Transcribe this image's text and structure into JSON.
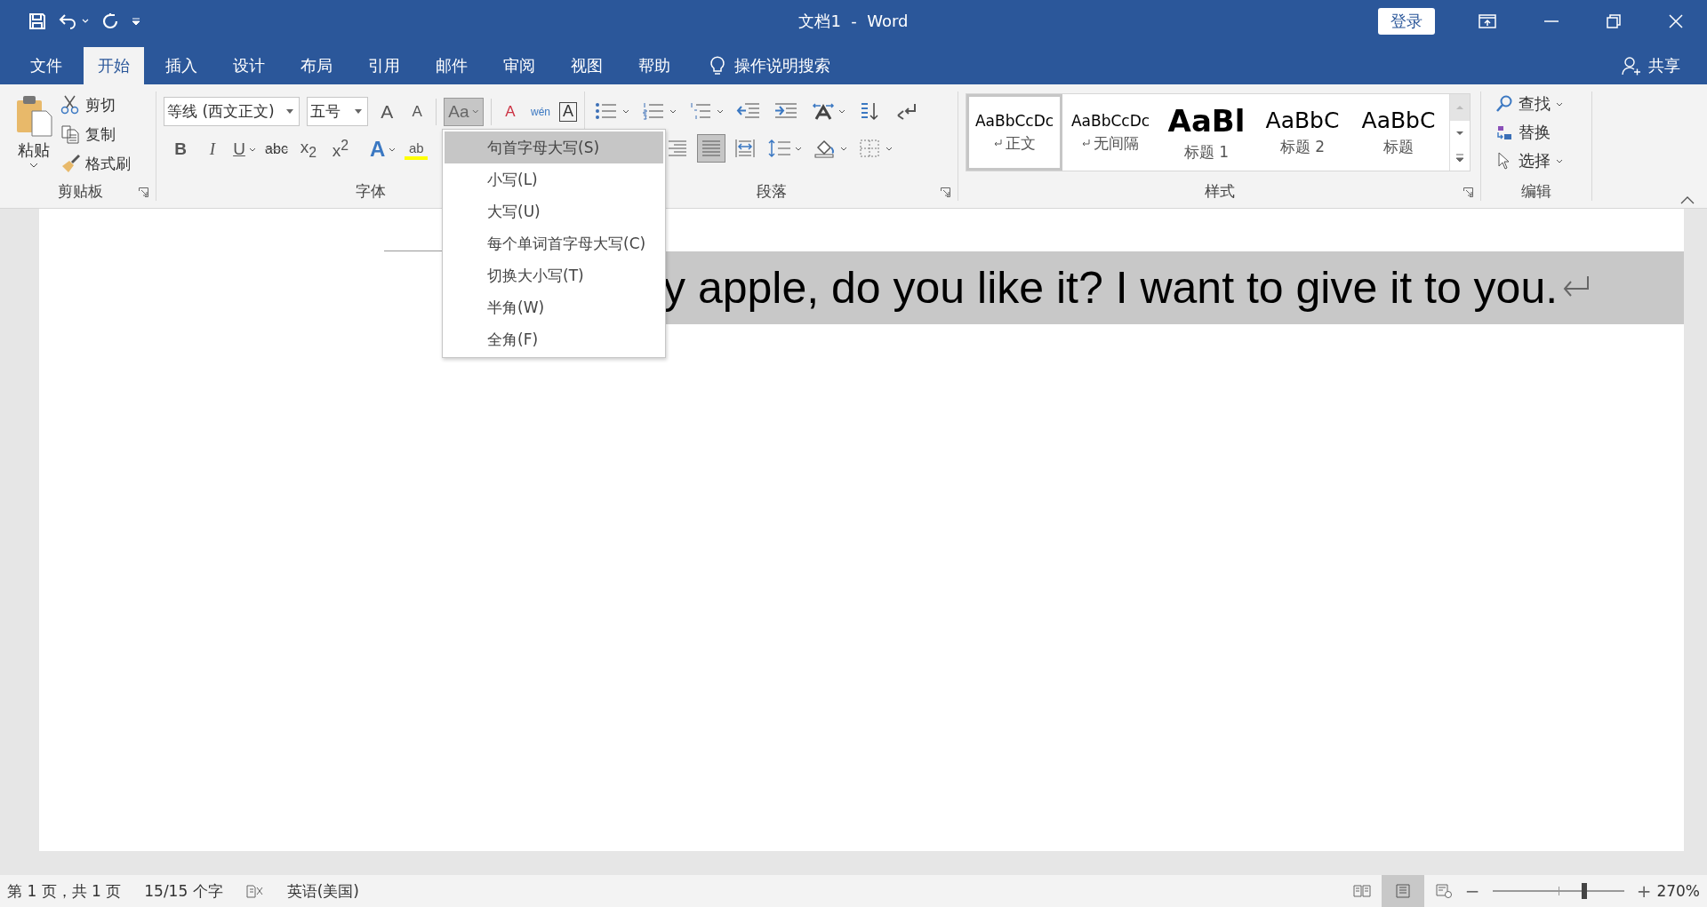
{
  "window": {
    "title": "文档1  -  Word",
    "login": "登录"
  },
  "tabs": [
    {
      "label": "文件",
      "selected": false
    },
    {
      "label": "开始",
      "selected": true
    },
    {
      "label": "插入",
      "selected": false
    },
    {
      "label": "设计",
      "selected": false
    },
    {
      "label": "布局",
      "selected": false
    },
    {
      "label": "引用",
      "selected": false
    },
    {
      "label": "邮件",
      "selected": false
    },
    {
      "label": "审阅",
      "selected": false
    },
    {
      "label": "视图",
      "selected": false
    },
    {
      "label": "帮助",
      "selected": false
    }
  ],
  "tell_me": "操作说明搜索",
  "share": "共享",
  "clipboard": {
    "paste": "粘贴",
    "items": [
      {
        "kind": "cut",
        "label": "剪切"
      },
      {
        "kind": "copy",
        "label": "复制"
      },
      {
        "kind": "painter",
        "label": "格式刷"
      }
    ],
    "label": "剪贴板"
  },
  "font": {
    "name": "等线 (西文正文)",
    "size": "五号",
    "label": "字体",
    "row1": [
      {
        "kind": "grow",
        "text": "A"
      },
      {
        "kind": "shrink",
        "text": "A"
      }
    ],
    "case_button": {
      "text": "Aa",
      "pressed": true
    },
    "row1b": [
      {
        "kind": "clear",
        "text": "A"
      },
      {
        "kind": "phonetic",
        "text": "wén"
      },
      {
        "kind": "border",
        "text": "A"
      }
    ],
    "row2": [
      {
        "kind": "bold",
        "text": "B"
      },
      {
        "kind": "italic",
        "text": "I"
      },
      {
        "kind": "underline",
        "text": "U"
      },
      {
        "kind": "strike",
        "text": "abc"
      },
      {
        "kind": "sub",
        "text": "x$_{2}$"
      },
      {
        "kind": "sup",
        "text": "x$^{2}$"
      },
      {
        "kind": "effects",
        "text": "A"
      },
      {
        "kind": "highlight",
        "text": "ab"
      }
    ]
  },
  "paragraph": {
    "label": "段落",
    "row1": [
      {
        "kind": "bullets"
      },
      {
        "kind": "numbering"
      },
      {
        "kind": "multilevel"
      },
      {
        "kind": "outdent"
      },
      {
        "kind": "indent"
      },
      {
        "kind": "asian"
      },
      {
        "kind": "sort"
      },
      {
        "kind": "marks"
      }
    ],
    "align": [
      {
        "kind": "right",
        "selected": false
      },
      {
        "kind": "justify",
        "selected": true
      },
      {
        "kind": "distributed",
        "selected": false
      }
    ],
    "row2": [
      {
        "kind": "spacing"
      },
      {
        "kind": "shading"
      },
      {
        "kind": "borders"
      }
    ]
  },
  "styles": {
    "label": "样式",
    "items": [
      {
        "sample": "AaBbCcDc",
        "name": "正文",
        "kind": "normal",
        "selected": true
      },
      {
        "sample": "AaBbCcDc",
        "name": "无间隔",
        "kind": "normal",
        "selected": false
      },
      {
        "sample": "AaBl",
        "name": "标题 1",
        "kind": "h1",
        "selected": false
      },
      {
        "sample": "AaBbC",
        "name": "标题 2",
        "kind": "h2",
        "selected": false
      },
      {
        "sample": "AaBbC",
        "name": "标题",
        "kind": "title",
        "selected": false
      }
    ]
  },
  "editing": {
    "label": "编辑",
    "items": [
      {
        "kind": "find",
        "label": "查找",
        "dropdown": true
      },
      {
        "kind": "replace",
        "label": "替换",
        "dropdown": false
      },
      {
        "kind": "select",
        "label": "选择",
        "dropdown": true
      }
    ]
  },
  "case_menu": {
    "items": [
      {
        "label": "句首字母大写(S)",
        "selected": true
      },
      {
        "label": "小写(L)",
        "selected": false
      },
      {
        "label": "大写(U)",
        "selected": false
      },
      {
        "label": "每个单词首字母大写(C)",
        "selected": false
      },
      {
        "label": "切换大小写(T)",
        "selected": false
      },
      {
        "label": "半角(W)",
        "selected": false
      },
      {
        "label": "全角(F)",
        "selected": false
      }
    ]
  },
  "document": {
    "text": "y apple, do you like it? I want to give it to you.",
    "selected": true
  },
  "status_bar": {
    "page": "第 1 页，共 1 页",
    "words": "15/15 个字",
    "language": "英语(美国)",
    "views": [
      {
        "kind": "read",
        "selected": false
      },
      {
        "kind": "print",
        "selected": true
      },
      {
        "kind": "web",
        "selected": false
      }
    ],
    "zoom": {
      "minus": "−",
      "plus": "+",
      "level": 0.7,
      "reading": "270%"
    }
  }
}
